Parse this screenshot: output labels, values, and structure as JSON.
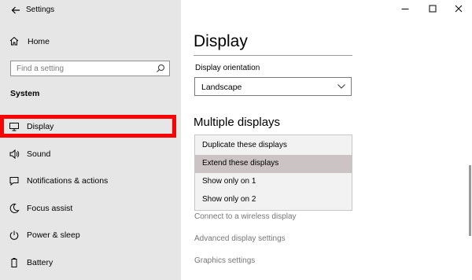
{
  "window": {
    "title": "Settings"
  },
  "sidebar": {
    "home_label": "Home",
    "search_placeholder": "Find a setting",
    "group_heading": "System",
    "items": [
      {
        "label": "Display",
        "icon": "monitor-icon",
        "selected": true
      },
      {
        "label": "Sound",
        "icon": "speaker-icon"
      },
      {
        "label": "Notifications & actions",
        "icon": "notification-icon"
      },
      {
        "label": "Focus assist",
        "icon": "moon-icon"
      },
      {
        "label": "Power & sleep",
        "icon": "power-icon"
      },
      {
        "label": "Battery",
        "icon": "battery-icon"
      }
    ]
  },
  "main": {
    "page_title": "Display",
    "orientation_label": "Display orientation",
    "orientation_value": "Landscape",
    "multiple_displays_heading": "Multiple displays",
    "multiple_display_options": [
      "Duplicate these displays",
      "Extend these displays",
      "Show only on 1",
      "Show only on 2"
    ],
    "selected_option": "Extend these displays",
    "links": [
      "Connect to a wireless display",
      "Advanced display settings",
      "Graphics settings"
    ]
  },
  "colors": {
    "sidebar_bg": "#e6e6e6",
    "highlight_red": "#ff0000",
    "selected_option_bg": "#ccc4c4",
    "link_gray": "#767676"
  }
}
